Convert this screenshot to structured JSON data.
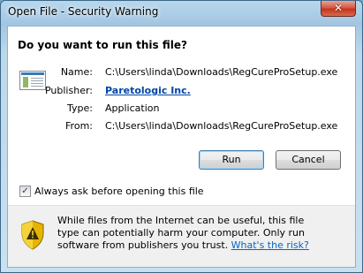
{
  "window": {
    "title": "Open File - Security Warning",
    "close_glyph": "✕"
  },
  "dialog": {
    "heading": "Do you want to run this file?",
    "file_icon": "application-file-icon",
    "fields": {
      "name_label": "Name:",
      "name_value": "C:\\Users\\linda\\Downloads\\RegCureProSetup.exe",
      "publisher_label": "Publisher:",
      "publisher_value": "Paretologic Inc.",
      "type_label": "Type:",
      "type_value": "Application",
      "from_label": "From:",
      "from_value": "C:\\Users\\linda\\Downloads\\RegCureProSetup.exe"
    },
    "buttons": {
      "run_label": "Run",
      "cancel_label": "Cancel"
    },
    "checkbox": {
      "label": "Always ask before opening this file",
      "checked": true,
      "glyph": "✓"
    },
    "warning": {
      "icon": "warning-shield-icon",
      "text": "While files from the Internet can be useful, this file type can potentially harm your computer. Only run software from publishers you trust.",
      "link_text": "What's the risk?"
    }
  },
  "colors": {
    "link": "#0066cc",
    "publisher_link": "#0046a8",
    "shield_yellow": "#f2c000"
  }
}
